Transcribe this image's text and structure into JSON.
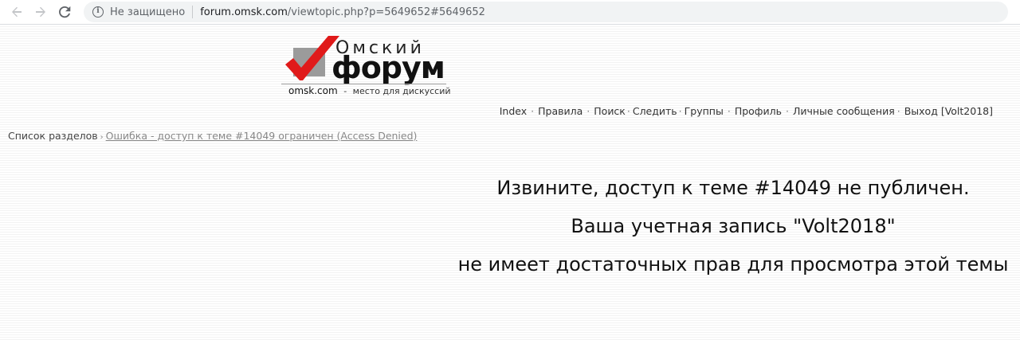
{
  "browser": {
    "back_icon": "arrow-left-icon",
    "forward_icon": "arrow-right-icon",
    "reload_icon": "reload-icon",
    "security_label": "Не защищено",
    "url_host": "forum.omsk.com",
    "url_path": "/viewtopic.php?p=5649652#5649652"
  },
  "logo": {
    "line1": "Омский",
    "line2": "форум",
    "domain": "omsk.com",
    "tagline": "место для дискуссий",
    "tagline_sep": "-",
    "colors": {
      "check": "#e01a1a",
      "box": "#9b9b9b"
    }
  },
  "nav": {
    "items": [
      {
        "label": "Index"
      },
      {
        "label": "Правила"
      },
      {
        "label": "Поиск"
      },
      {
        "label": "Следить"
      },
      {
        "label": "Группы"
      },
      {
        "label": "Профиль"
      },
      {
        "label": "Личные сообщения"
      },
      {
        "label": "Выход [Volt2018]"
      }
    ],
    "separator": "·"
  },
  "breadcrumb": {
    "root": "Список разделов",
    "current": "Ошибка - доступ к теме #14049 ограничен (Access Denied)"
  },
  "message": {
    "line1": "Извините, доступ к теме #14049 не публичен.",
    "line2": "Ваша учетная запись \"Volt2018\"",
    "line3": "не имеет достаточных прав для просмотра этой темы"
  }
}
